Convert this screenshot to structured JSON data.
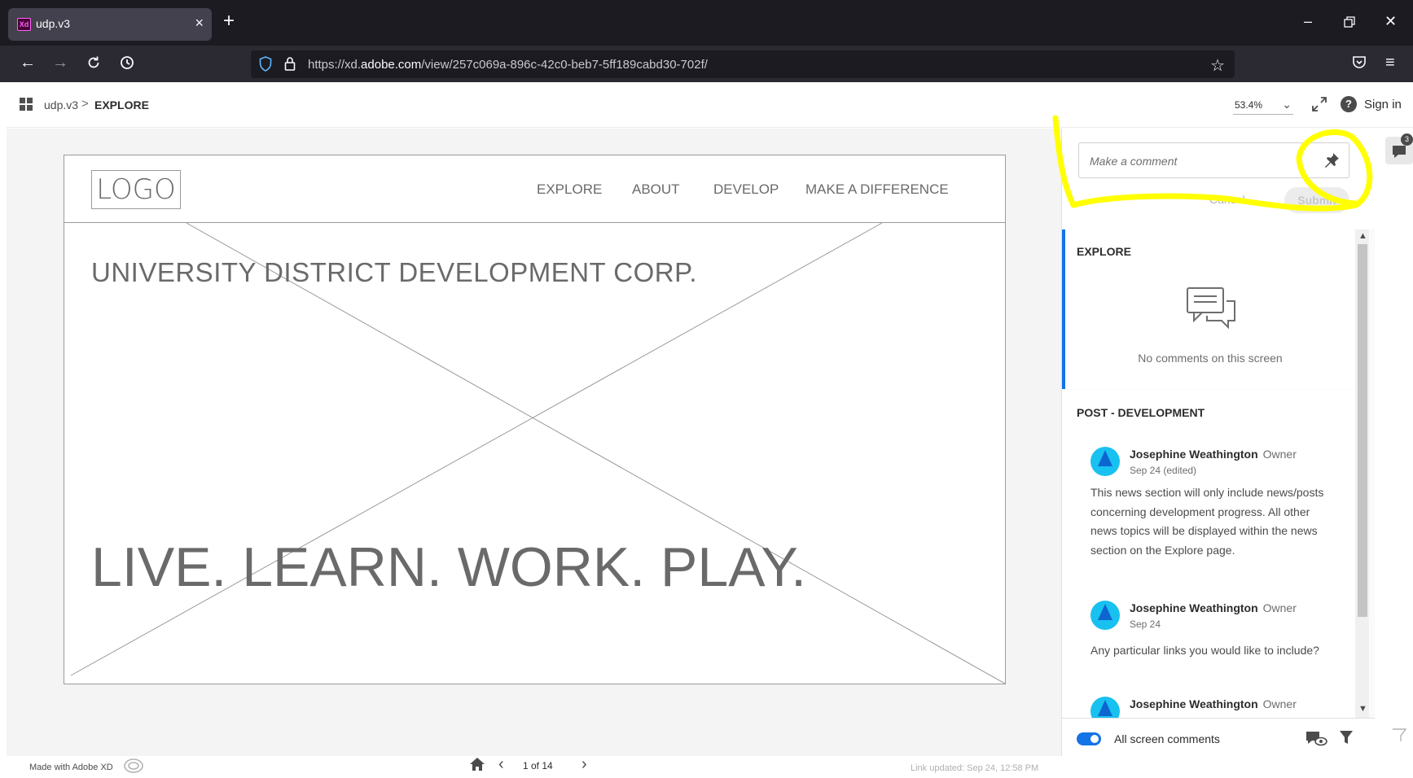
{
  "browser": {
    "tab_title": "udp.v3",
    "tab_favicon": "Xd",
    "url_prefix": "https://xd.",
    "url_domain": "adobe.com",
    "url_path": "/view/257c069a-896c-42c0-beb7-5ff189cabd30-702f/"
  },
  "header": {
    "breadcrumb_doc": "udp.v3",
    "breadcrumb_sep": ">",
    "breadcrumb_screen": "EXPLORE",
    "zoom": "53.4%",
    "sign_in": "Sign in",
    "help": "?"
  },
  "artboard": {
    "logo": "LOGO",
    "nav": [
      "EXPLORE",
      "ABOUT",
      "DEVELOP",
      "MAKE A DIFFERENCE"
    ],
    "title": "UNIVERSITY DISTRICT DEVELOPMENT CORP.",
    "tagline": "LIVE. LEARN. WORK. PLAY."
  },
  "footer": {
    "made_with": "Made with Adobe XD",
    "page": "1 of 14",
    "link_updated": "Link updated: Sep 24, 12:58 PM"
  },
  "comments": {
    "input_placeholder": "Make a comment",
    "cancel": "Cancel",
    "submit": "Submit",
    "sections": [
      {
        "title": "EXPLORE",
        "empty": "No comments on this screen"
      },
      {
        "title": "POST - DEVELOPMENT",
        "items": [
          {
            "author": "Josephine Weathington",
            "role": "Owner",
            "date": "Sep 24 (edited)",
            "body": "This news section will only include news/posts concerning development progress. All other news topics will be displayed within the news section on the Explore page."
          },
          {
            "author": "Josephine Weathington",
            "role": "Owner",
            "date": "Sep 24",
            "body": "Any particular links you would like to include?"
          },
          {
            "author": "Josephine Weathington",
            "role": "Owner",
            "date": "",
            "body": ""
          }
        ]
      }
    ],
    "toggle_label": "All screen comments",
    "badge_count": "3"
  },
  "colors": {
    "accent": "#1473e6",
    "highlight": "#ffff00",
    "avatar": "#18c1f0"
  }
}
